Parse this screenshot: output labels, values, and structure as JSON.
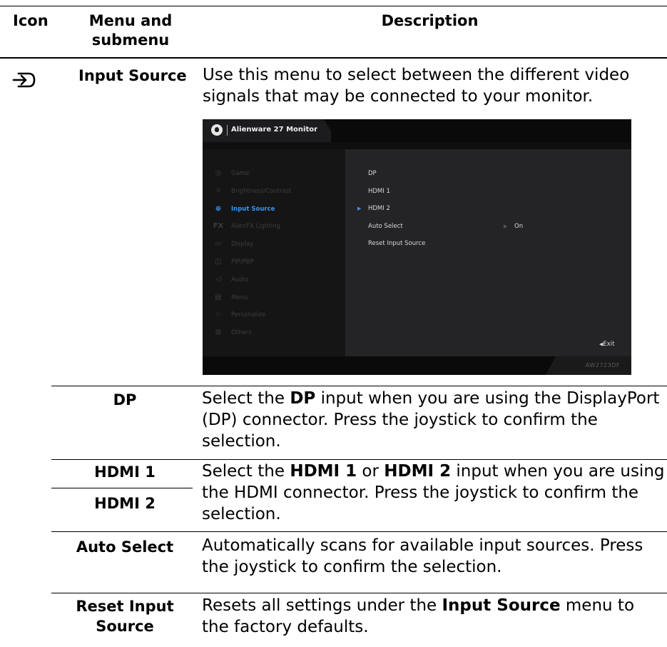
{
  "header": {
    "col_icon": "Icon",
    "col_menu": "Menu and submenu",
    "col_desc": "Description"
  },
  "main_row": {
    "icon": "input-source-icon",
    "label": "Input Source",
    "description": "Use this menu to select between the different video signals that may be connected to your monitor."
  },
  "osd": {
    "title": "Alienware 27 Monitor",
    "menu": [
      {
        "icon": "gamepad-icon",
        "label": "Game"
      },
      {
        "icon": "brightness-icon",
        "label": "Brightness/Contrast"
      },
      {
        "icon": "input-source-icon",
        "label": "Input Source",
        "active": true
      },
      {
        "icon": "fx-icon",
        "label": "AlienFX Lighting"
      },
      {
        "icon": "display-icon",
        "label": "Display"
      },
      {
        "icon": "pip-icon",
        "label": "PIP/PBP"
      },
      {
        "icon": "audio-icon",
        "label": "Audio"
      },
      {
        "icon": "menu-icon",
        "label": "Menu"
      },
      {
        "icon": "star-icon",
        "label": "Personalize"
      },
      {
        "icon": "others-icon",
        "label": "Others"
      }
    ],
    "options": {
      "dp": "DP",
      "hdmi1": "HDMI 1",
      "hdmi2": "HDMI 2",
      "auto_select": "Auto Select",
      "auto_select_value": "On",
      "reset": "Reset Input Source"
    },
    "exit_label": "Exit",
    "model": "AW2723DF",
    "accent_color": "#3c93ee"
  },
  "rows": {
    "dp": {
      "label": "DP",
      "desc_pre": "Select the ",
      "desc_bold": "DP",
      "desc_post": " input when you are using the DisplayPort (DP) connector. Press the joystick to confirm the selection."
    },
    "hdmi": {
      "label1": "HDMI 1",
      "label2": "HDMI 2",
      "desc_pre": "Select the ",
      "desc_bold1": "HDMI 1",
      "desc_mid": " or ",
      "desc_bold2": "HDMI 2",
      "desc_post": " input when you are using the HDMI connector. Press the joystick to confirm the selection."
    },
    "auto": {
      "label": "Auto Select",
      "desc": "Automatically scans for available input sources. Press the joystick to confirm the selection."
    },
    "reset": {
      "label_line1": "Reset Input",
      "label_line2": "Source",
      "desc_pre": "Resets all settings under the ",
      "desc_bold": "Input Source",
      "desc_post": " menu to the factory defaults."
    }
  }
}
